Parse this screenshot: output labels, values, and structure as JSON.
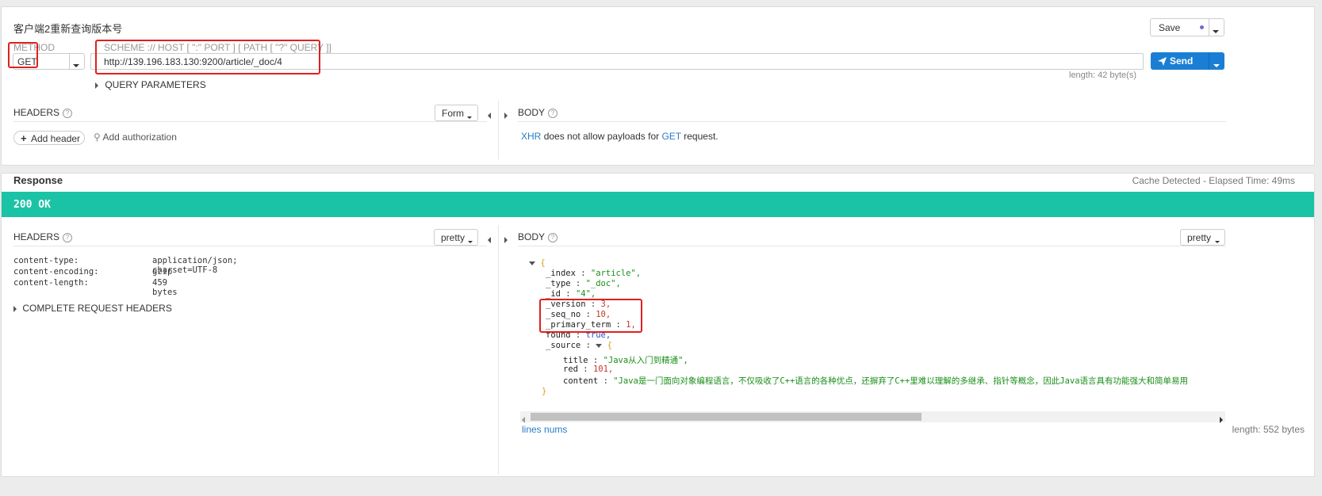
{
  "request": {
    "name": "客户端2重新查询版本号",
    "save_label": "Save",
    "method_label": "METHOD",
    "method": "GET",
    "url_hint": "SCHEME :// HOST [ \":\" PORT ] [ PATH [ \"?\" QUERY ]]",
    "url": "http://139.196.183.130:9200/article/_doc/4",
    "send_label": "Send",
    "url_length": "length: 42 byte(s)",
    "query_params_label": "QUERY PARAMETERS",
    "headers_label": "HEADERS",
    "headers_mode": "Form",
    "add_header_label": "Add header",
    "add_auth_label": "Add authorization",
    "body_label": "BODY",
    "body_msg": {
      "xhr": "XHR",
      "middle": "does not allow payloads for",
      "method": "GET",
      "end": "request."
    }
  },
  "response": {
    "title": "Response",
    "cache_info": "Cache Detected - Elapsed Time: 49ms",
    "status": "200 OK",
    "status_color": "#1bc3a6",
    "headers_label": "HEADERS",
    "headers_mode": "pretty",
    "headers": [
      {
        "name": "content-type:",
        "value": "application/json; charset=UTF-8"
      },
      {
        "name": "content-encoding:",
        "value": "gzip"
      },
      {
        "name": "content-length:",
        "value": "459 bytes"
      }
    ],
    "complete_headers_label": "COMPLETE REQUEST HEADERS",
    "body_label": "BODY",
    "body_mode": "pretty",
    "json": {
      "open": "{",
      "index_key": "_index",
      "index_val": "\"article\",",
      "type_key": "_type",
      "type_val": "\"_doc\",",
      "id_key": "_id",
      "id_val": "\"4\",",
      "version_key": "_version",
      "version_val": "3,",
      "seq_key": "_seq_no",
      "seq_val": "10,",
      "term_key": "_primary_term",
      "term_val": "1,",
      "found_key": "found",
      "found_val": "true,",
      "source_key": "_source",
      "title_key": "title",
      "title_val": "\"Java从入门到精通\",",
      "red_key": "red",
      "red_val": "101,",
      "content_key": "content",
      "content_val": "\"Java是一门面向对象编程语言，不仅吸收了C++语言的各种优点，还摒弃了C++里难以理解的多继承、指针等概念，因此Java语言具有功能强大和简单易用",
      "close_inner": "}",
      "close": "}"
    },
    "lines_nums_label": "lines nums",
    "body_length": "length: 552 bytes"
  },
  "colors": {
    "accent": "#1a7fd4",
    "status": "#1bc3a6",
    "highlight": "#e02020"
  }
}
